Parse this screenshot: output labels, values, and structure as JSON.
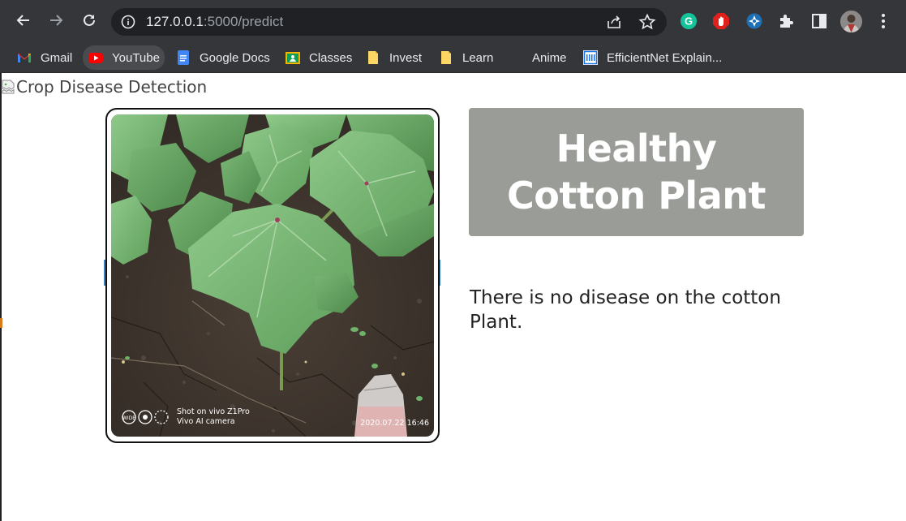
{
  "browser": {
    "url_host": "127.0.0.1",
    "url_path": ":5000/predict",
    "bookmarks": [
      {
        "label": "Gmail",
        "icon": "gmail-icon"
      },
      {
        "label": "YouTube",
        "icon": "youtube-icon"
      },
      {
        "label": "Google Docs",
        "icon": "google-docs-icon"
      },
      {
        "label": "Classes",
        "icon": "google-classroom-icon"
      },
      {
        "label": "Invest",
        "icon": "folder-icon"
      },
      {
        "label": "Learn",
        "icon": "folder-icon"
      },
      {
        "label": "Anime",
        "icon": "blank-page-icon"
      },
      {
        "label": "EfficientNet Explain...",
        "icon": "site-favicon-icon"
      }
    ],
    "extensions": [
      "grammarly-icon",
      "adblock-icon",
      "extension-icon",
      "puzzle-extensions-icon",
      "side-panel-icon",
      "profile-avatar",
      "menu-kebab-icon"
    ]
  },
  "page": {
    "logo_alt": "Crop Disease Detection",
    "photo": {
      "watermark_line1": "Shot on vivo Z1Pro",
      "watermark_line2": "Vivo AI camera",
      "timestamp": "2020.07.22 16:46"
    },
    "result_title": "Healthy Cotton Plant",
    "result_description": "There is no disease on the cotton Plant."
  },
  "colors": {
    "chrome_bg": "#35363a",
    "omnibox_bg": "#202124",
    "result_box": "#9a9c97",
    "text_dark": "#222222"
  }
}
